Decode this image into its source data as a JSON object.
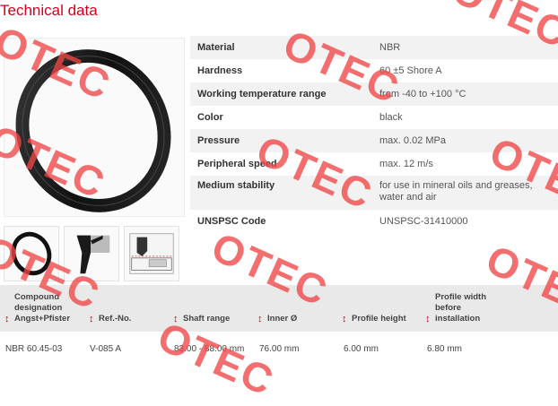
{
  "page": {
    "title": "Technical data"
  },
  "specs": [
    {
      "label": "Material",
      "value": "NBR"
    },
    {
      "label": "Hardness",
      "value": "60 ±5 Shore A"
    },
    {
      "label": "Working temperature range",
      "value": "from -40 to +100 °C"
    },
    {
      "label": "Color",
      "value": "black"
    },
    {
      "label": "Pressure",
      "value": "max. 0.02 MPa"
    },
    {
      "label": "Peripheral speed",
      "value": "max. 12 m/s"
    },
    {
      "label": "Medium stability",
      "value": "for use in mineral oils and greases, water and air"
    },
    {
      "label": "UNSPSC Code",
      "value": "UNSPSC-31410000"
    }
  ],
  "compound_table": {
    "headers": [
      {
        "line1": "Compound",
        "line2": "designation",
        "line3": "Angst+Pfister"
      },
      {
        "line1": "Ref.-No."
      },
      {
        "line1": "Shaft range"
      },
      {
        "line1": "Inner Ø"
      },
      {
        "line1": "Profile height"
      },
      {
        "line1": "Profile width",
        "line2": "before",
        "line3": "installation"
      }
    ],
    "row": [
      "NBR 60.45-03",
      "V-085 A",
      "83.00 - 88.00 mm",
      "76.00 mm",
      "6.00 mm",
      "6.80 mm"
    ]
  },
  "watermark": {
    "text": "OTEC"
  },
  "colors": {
    "accent": "#d0021b",
    "watermark": "#f04646",
    "row_alt": "#f2f2f2",
    "header_bg": "#e9e9e9"
  },
  "icons": {
    "sort": "sort-arrows-icon"
  }
}
